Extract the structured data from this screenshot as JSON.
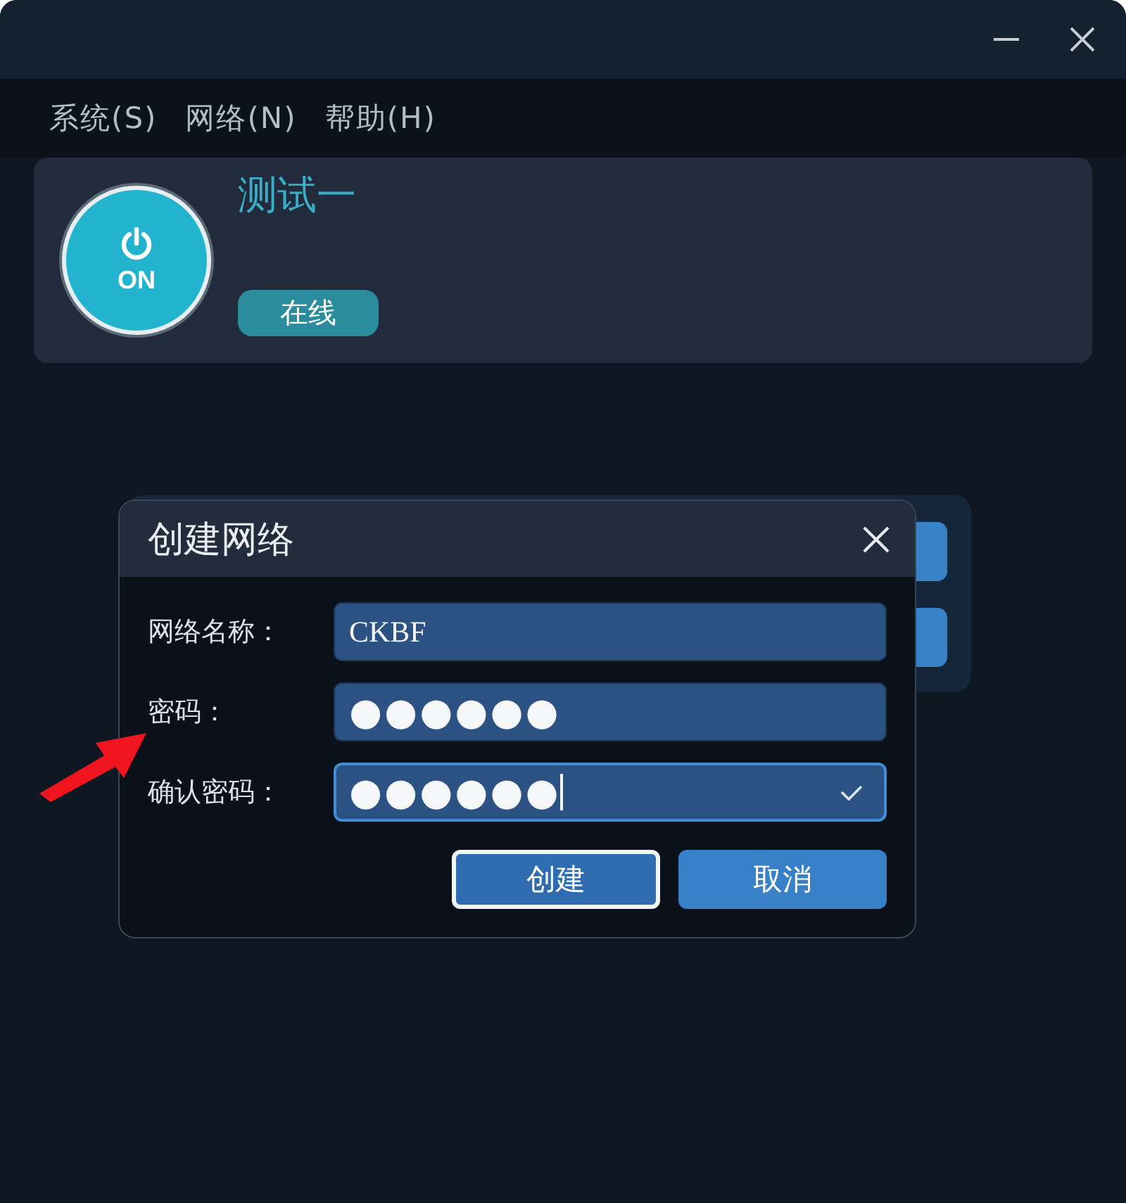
{
  "menu": [
    {
      "label": "系统(S)"
    },
    {
      "label": "网络(N)"
    },
    {
      "label": "帮助(H)"
    }
  ],
  "device": {
    "power": {
      "label": "ON",
      "on": true
    },
    "name": "测试一",
    "status": "在线"
  },
  "dialog": {
    "title": "创建网络",
    "fields": [
      {
        "label": "网络名称：",
        "value": "CKBF",
        "kind": "text",
        "focused": false,
        "valid": false
      },
      {
        "label": "密码：",
        "value": "●●●●●●",
        "kind": "password",
        "focused": false,
        "valid": false
      },
      {
        "label": "确认密码：",
        "value": "●●●●●●",
        "kind": "password",
        "focused": true,
        "valid": true
      }
    ],
    "buttons": [
      {
        "label": "创建",
        "default": true
      },
      {
        "label": "取消",
        "default": false
      }
    ]
  }
}
